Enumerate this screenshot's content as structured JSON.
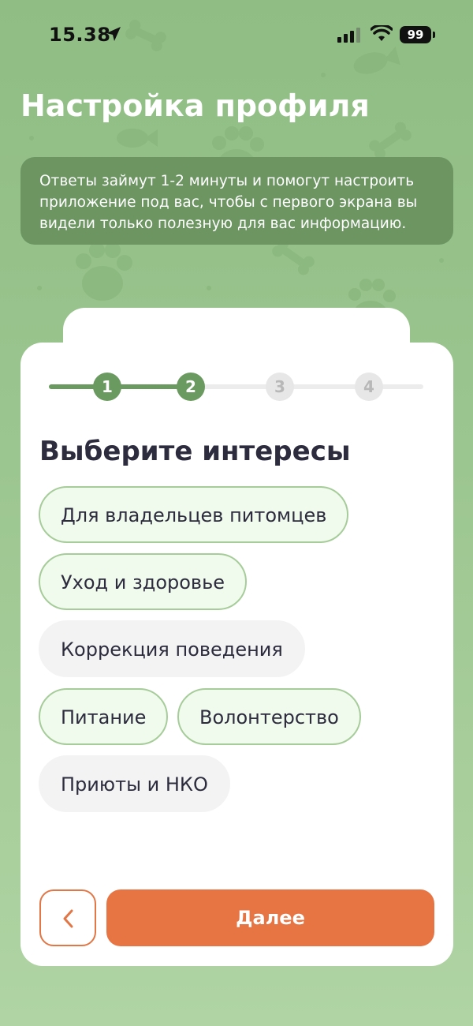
{
  "status_bar": {
    "time": "15.38",
    "battery": "99",
    "icons": [
      "location-arrow-icon",
      "cellular-signal-icon",
      "wifi-icon",
      "battery-icon"
    ]
  },
  "header": {
    "title": "Настройка профиля",
    "info_lines": [
      "Ответы займут 1-2 минуты и помогут настроить",
      "приложение под вас, чтобы с первого экрана вы",
      "видели только полезную для вас информацию."
    ]
  },
  "stepper": {
    "current_step": 2,
    "total_steps": 4,
    "steps": [
      "1",
      "2",
      "3",
      "4"
    ]
  },
  "section": {
    "title": "Выберите интересы"
  },
  "interests": [
    {
      "label": "Для владельцев питомцев",
      "selected": true
    },
    {
      "label": "Уход и здоровье",
      "selected": true
    },
    {
      "label": "Коррекция поведения",
      "selected": false
    },
    {
      "label": "Питание",
      "selected": true
    },
    {
      "label": "Волонтерство",
      "selected": true
    },
    {
      "label": "Приюты и НКО",
      "selected": false
    }
  ],
  "actions": {
    "back_icon": "chevron-left-icon",
    "next_label": "Далее"
  },
  "colors": {
    "background": "#9cc690",
    "primary_green": "#6b9a61",
    "chip_selected_bg": "#f1fbed",
    "chip_selected_border": "#a6cc9a",
    "chip_unselected_bg": "#f3f3f3",
    "accent_orange": "#e77443",
    "text_dark": "#2c2c3e"
  }
}
